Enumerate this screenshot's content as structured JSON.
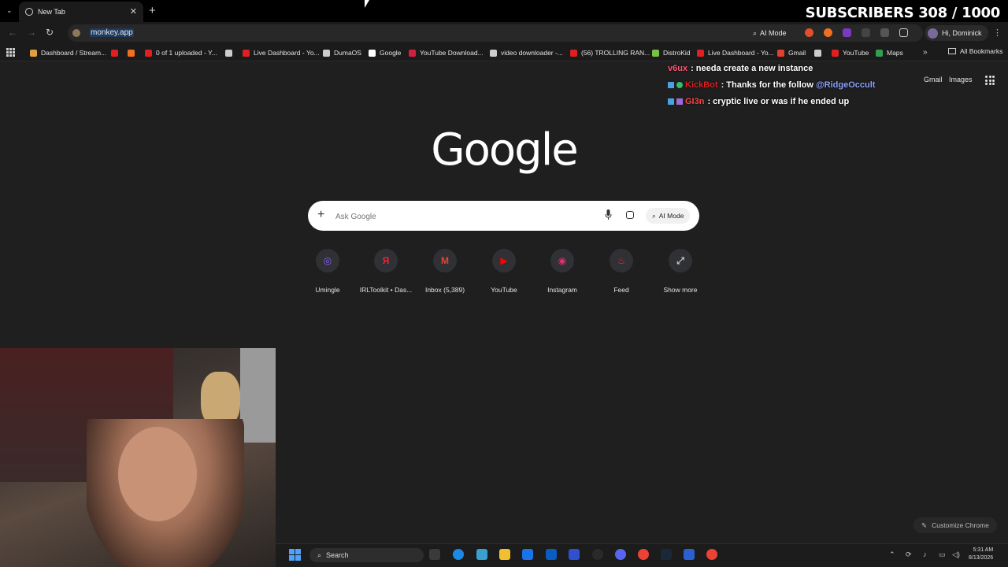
{
  "browser": {
    "tab": {
      "title": "New Tab"
    },
    "address": "monkey.app",
    "ai_mode": "AI Mode",
    "profile": "Hi, Dominick"
  },
  "overlay": {
    "subscribers": "SUBSCRIBERS 308 / 1000"
  },
  "bookmarks": [
    {
      "label": "Dashboard / Stream...",
      "color": "#e0a040"
    },
    {
      "label": "",
      "color": "#e02020"
    },
    {
      "label": "",
      "color": "#f07020"
    },
    {
      "label": "0 of 1 uploaded - Y...",
      "color": "#e02020"
    },
    {
      "label": "",
      "color": "#cccccc"
    },
    {
      "label": "Live Dashboard - Yo...",
      "color": "#e02020"
    },
    {
      "label": "DumaOS",
      "color": "#cccccc"
    },
    {
      "label": "Google",
      "color": "#ffffff"
    },
    {
      "label": "YouTube Download...",
      "color": "#d02040"
    },
    {
      "label": "video downloader -...",
      "color": "#cccccc"
    },
    {
      "label": "(56) TROLLING RAN...",
      "color": "#e02020"
    },
    {
      "label": "DistroKid",
      "color": "#7ac040"
    },
    {
      "label": "Live Dashboard - Yo...",
      "color": "#e02020"
    },
    {
      "label": "Gmail",
      "color": "#e04030"
    },
    {
      "label": "",
      "color": "#cccccc"
    },
    {
      "label": "YouTube",
      "color": "#e02020"
    },
    {
      "label": "Maps",
      "color": "#30a050"
    }
  ],
  "all_bookmarks": "All Bookmarks",
  "chat": [
    {
      "user": "v6ux",
      "user_color": "#ff5577",
      "message": ": needa create a new instance",
      "mention": ""
    },
    {
      "user": "KickBot",
      "user_color": "#e02020",
      "message": ": Thanks for the follow ",
      "mention": "@RidgeOccult"
    },
    {
      "user": "GI3n",
      "user_color": "#ff4444",
      "message": ": cryptic live or was if he ended up",
      "mention": ""
    }
  ],
  "header_links": {
    "gmail": "Gmail",
    "images": "Images"
  },
  "logo": "Google",
  "search": {
    "placeholder": "Ask Google",
    "ai_mode": "AI Mode"
  },
  "shortcuts": [
    {
      "label": "Umingle",
      "glyph": "◎",
      "color": "#8a5cff"
    },
    {
      "label": "IRLToolkit • Das...",
      "glyph": "Я",
      "color": "#e0283c"
    },
    {
      "label": "Inbox (5,389)",
      "glyph": "M",
      "color": "#e94235"
    },
    {
      "label": "YouTube",
      "glyph": "▶",
      "color": "#ff0000"
    },
    {
      "label": "Instagram",
      "glyph": "◉",
      "color": "#e1306c"
    },
    {
      "label": "Feed",
      "glyph": "♨",
      "color": "#e0283c"
    },
    {
      "label": "Show more",
      "glyph": "⤢",
      "color": "#cccccc"
    }
  ],
  "customize": "Customize Chrome",
  "taskbar": {
    "search": "Search",
    "time": "5:31 AM",
    "date": "8/13/2026"
  }
}
